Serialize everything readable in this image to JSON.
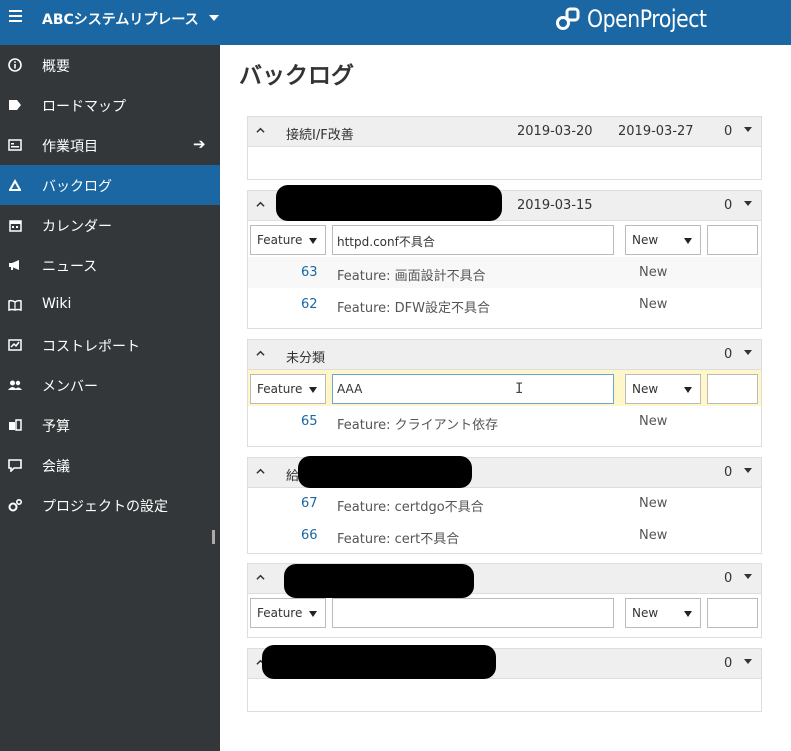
{
  "header": {
    "project_name": "ABCシステムリプレース",
    "logo_text": "OpenProject"
  },
  "sidebar": {
    "items": [
      {
        "label": "概要",
        "icon": "info-icon"
      },
      {
        "label": "ロードマップ",
        "icon": "tag-icon"
      },
      {
        "label": "作業項目",
        "icon": "work-packages-icon"
      },
      {
        "label": "バックログ",
        "icon": "backlogs-icon",
        "active": true
      },
      {
        "label": "カレンダー",
        "icon": "calendar-icon"
      },
      {
        "label": "ニュース",
        "icon": "megaphone-icon"
      },
      {
        "label": "Wiki",
        "icon": "book-icon"
      },
      {
        "label": "コストレポート",
        "icon": "cost-report-icon"
      },
      {
        "label": "メンバー",
        "icon": "members-icon"
      },
      {
        "label": "予算",
        "icon": "budget-icon"
      },
      {
        "label": "会議",
        "icon": "meetings-icon"
      },
      {
        "label": "プロジェクトの設定",
        "icon": "settings-icon"
      }
    ]
  },
  "main": {
    "title": "バックログ",
    "sprints": [
      {
        "name": "接続I/F改善",
        "start": "2019-03-20",
        "end": "2019-03-27",
        "points": "0"
      },
      {
        "name": "",
        "start": "2019-03-15",
        "end": "",
        "points": "0",
        "new_row": {
          "type": "Feature",
          "subject": "httpd.conf不具合",
          "status": "New",
          "points": ""
        },
        "stories": [
          {
            "id": "63",
            "subject": "Feature: 画面設計不具合",
            "status": "New"
          },
          {
            "id": "62",
            "subject": "Feature: DFW設定不具合",
            "status": "New"
          }
        ]
      },
      {
        "name": "未分類",
        "start": "",
        "end": "",
        "points": "0",
        "new_row": {
          "type": "Feature",
          "subject": "AAA",
          "status": "New",
          "points": ""
        },
        "stories": [
          {
            "id": "65",
            "subject": "Feature: クライアント依存",
            "status": "New"
          }
        ]
      },
      {
        "name": "給",
        "start": "",
        "end": "",
        "points": "0",
        "stories": [
          {
            "id": "67",
            "subject": "Feature: certdgo不具合",
            "status": "New"
          },
          {
            "id": "66",
            "subject": "Feature: cert不具合",
            "status": "New"
          }
        ]
      },
      {
        "name": "",
        "start": "",
        "end": "",
        "points": "0",
        "new_row": {
          "type": "Feature",
          "subject": "",
          "status": "New",
          "points": ""
        }
      },
      {
        "name": "",
        "start": "",
        "end": "",
        "points": "0"
      }
    ]
  },
  "colors": {
    "header_bg": "#1a67a3",
    "sidebar_bg": "#333739",
    "active_bg": "#1a67a3",
    "link": "#1a67a3",
    "highlight_row": "#fff6c9"
  }
}
